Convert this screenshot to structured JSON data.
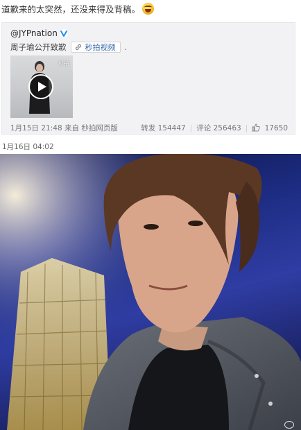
{
  "post": {
    "text": "道歉来的太突然，还没来得及背稿。",
    "emoji": "laughing-face-emoji",
    "time": "1月16日 04:02"
  },
  "repost": {
    "author": "@JYPnation",
    "verified": true,
    "subtitle": "周子瑜公开致歉",
    "video_link_label": "秒拍视频",
    "trailing_dot": ".",
    "video_logo": "秒拍",
    "meta": "1月15日 21:48 来自 秒拍网页版",
    "reposts_label": "转发",
    "reposts": "154447",
    "comments_label": "评论",
    "comments": "256463",
    "likes": "17650"
  },
  "colors": {
    "link": "#3566a8",
    "verified": "#1a8fe6",
    "panel_bg": "#f2f2f5"
  }
}
